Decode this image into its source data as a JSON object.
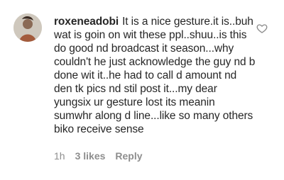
{
  "comment": {
    "username": "roxeneadobi",
    "text": "It is a nice gesture.it is..buh wat is goin on wit these ppl..shuu..is this do good nd broadcast it season...why couldn't he just acknowledge the guy nd b done wit it..he had to call d amount nd den tk pics nd stil post it...my dear yungsix ur gesture lost its meanin sumwhr along d line...like so many others biko receive sense",
    "time": "1h",
    "likes": "3 likes",
    "reply_label": "Reply"
  },
  "icons": {
    "like": "heart-outline-icon",
    "avatar": "profile-avatar"
  },
  "colors": {
    "text": "#262626",
    "meta": "#8e8e8e",
    "heart": "#8e8e8e"
  }
}
